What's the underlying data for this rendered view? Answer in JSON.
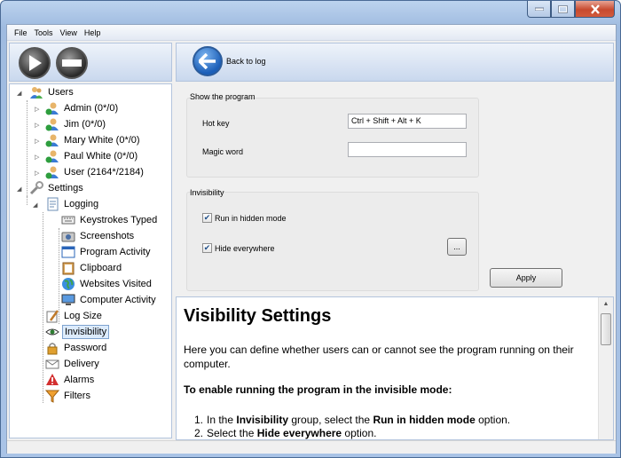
{
  "menu": [
    "File",
    "Tools",
    "View",
    "Help"
  ],
  "toolbar": {
    "back_label": "Back to log"
  },
  "tree": {
    "users_label": "Users",
    "users": [
      "Admin (0*/0)",
      "Jim (0*/0)",
      "Mary White (0*/0)",
      "Paul White (0*/0)",
      "User (2164*/2184)"
    ],
    "settings_label": "Settings",
    "logging_label": "Logging",
    "logging_items": [
      "Keystrokes Typed",
      "Screenshots",
      "Program Activity",
      "Clipboard",
      "Websites Visited",
      "Computer Activity"
    ],
    "settings_items": [
      "Log Size",
      "Invisibility",
      "Password",
      "Delivery",
      "Alarms",
      "Filters"
    ],
    "selected": "Invisibility"
  },
  "show_program": {
    "title": "Show the program",
    "hotkey_label": "Hot key",
    "hotkey_value": "Ctrl + Shift + Alt + K",
    "magic_label": "Magic word",
    "magic_value": ""
  },
  "invisibility": {
    "title": "Invisibility",
    "run_hidden_label": "Run in hidden mode",
    "run_hidden_checked": true,
    "hide_everywhere_label": "Hide everywhere",
    "hide_everywhere_checked": true,
    "ellipsis_label": "..."
  },
  "apply_label": "Apply",
  "help": {
    "heading": "Visibility Settings",
    "intro": "Here you can define whether users can or cannot see the program running on their computer.",
    "subheading": "To enable running the program in the invisible mode:",
    "step1_num": "1.",
    "step1_a": "In the ",
    "step1_b": "Invisibility",
    "step1_c": " group, select the ",
    "step1_d": "Run in hidden mode",
    "step1_e": " option.",
    "step2_num": "2.",
    "step2_a": "Select the ",
    "step2_b": "Hide everywhere",
    "step2_c": " option."
  }
}
